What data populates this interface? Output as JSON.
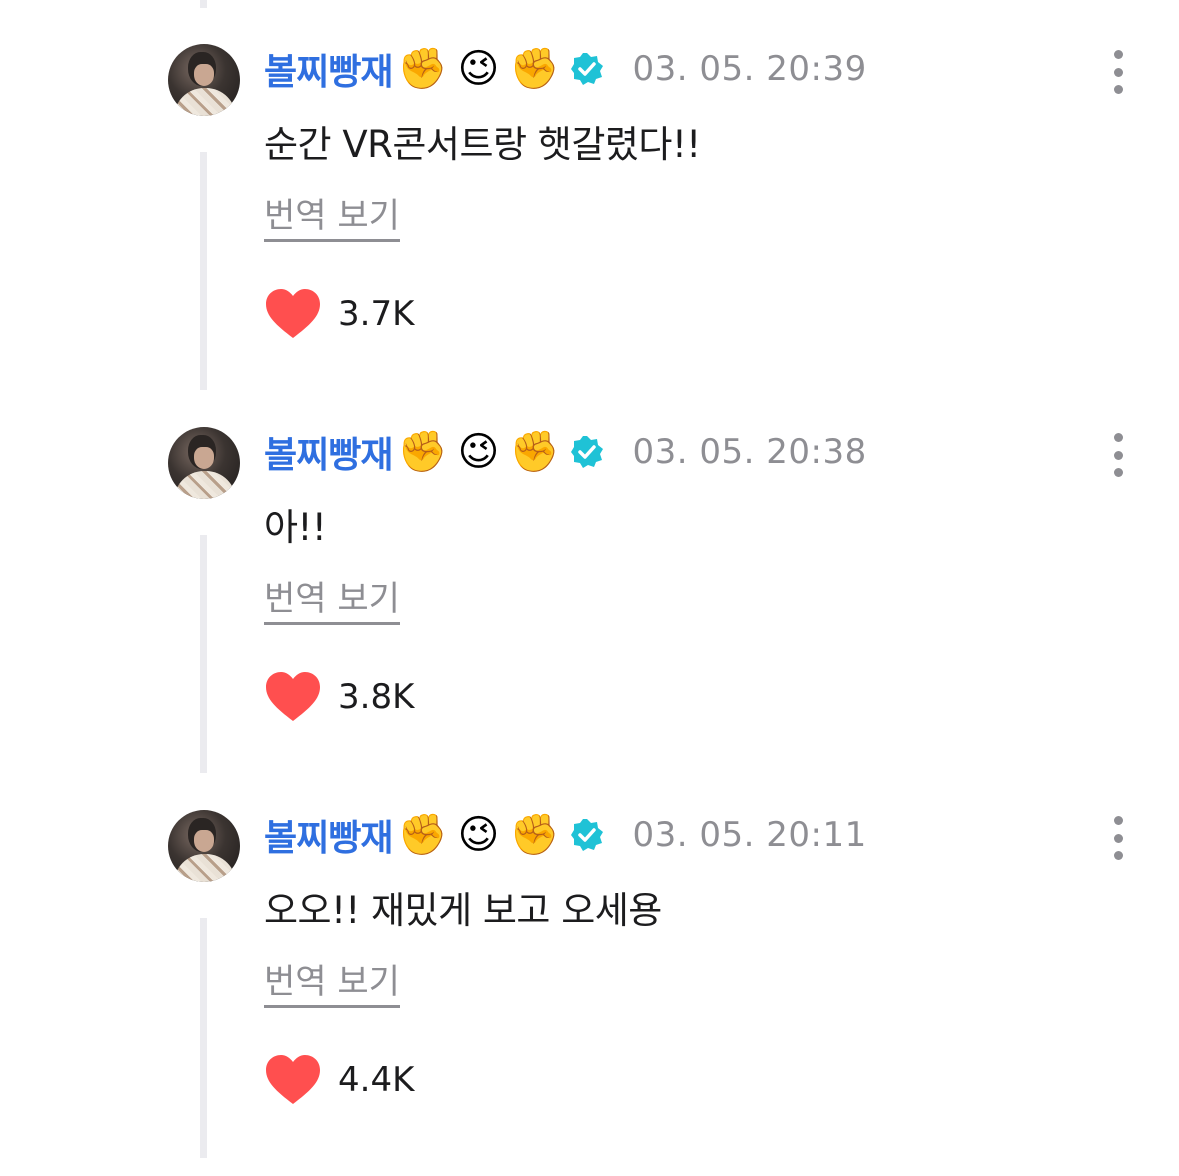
{
  "colors": {
    "author": "#2f6fe0",
    "timestamp": "#8e8e93",
    "heart": "#ff4f4f",
    "badge": "#1fc2d6",
    "thread_line": "#ebebef"
  },
  "comments": [
    {
      "author": "볼찌빵재",
      "emojis": [
        "✊",
        "😉",
        "✊"
      ],
      "verified_icon": "verified-badge-icon",
      "timestamp": "03. 05. 20:39",
      "text": "순간 VR콘서트랑 햇갈렸다!!",
      "translate_label": "번역 보기",
      "likes": "3.7K"
    },
    {
      "author": "볼찌빵재",
      "emojis": [
        "✊",
        "😉",
        "✊"
      ],
      "verified_icon": "verified-badge-icon",
      "timestamp": "03. 05. 20:38",
      "text": "아!!",
      "translate_label": "번역 보기",
      "likes": "3.8K"
    },
    {
      "author": "볼찌빵재",
      "emojis": [
        "✊",
        "😉",
        "✊"
      ],
      "verified_icon": "verified-badge-icon",
      "timestamp": "03. 05. 20:11",
      "text": "오오!! 재밌게 보고 오세용",
      "translate_label": "번역 보기",
      "likes": "4.4K"
    }
  ]
}
